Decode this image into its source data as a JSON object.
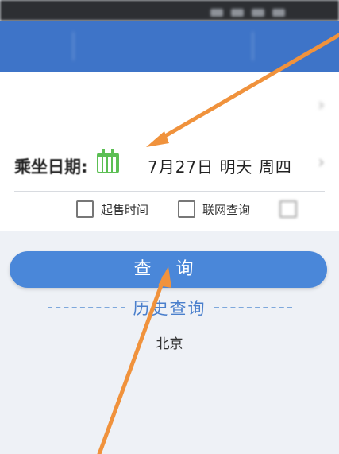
{
  "form": {
    "date_label": "乘坐日期:",
    "date_value": "7月27日  明天  周四",
    "checkboxes": [
      {
        "label": "起售时间",
        "checked": false
      },
      {
        "label": "联网查询",
        "checked": false
      }
    ]
  },
  "query_button_label": "查 询",
  "history": {
    "title": "历史查询",
    "items": [
      "北京"
    ]
  },
  "colors": {
    "nav_blue": "#3e74c8",
    "button_blue": "#4a87d9",
    "calendar_green": "#5cbf54",
    "annotation_orange": "#f0923c"
  },
  "icons": {
    "calendar": "calendar-icon",
    "chevron": "chevron-right-icon"
  }
}
